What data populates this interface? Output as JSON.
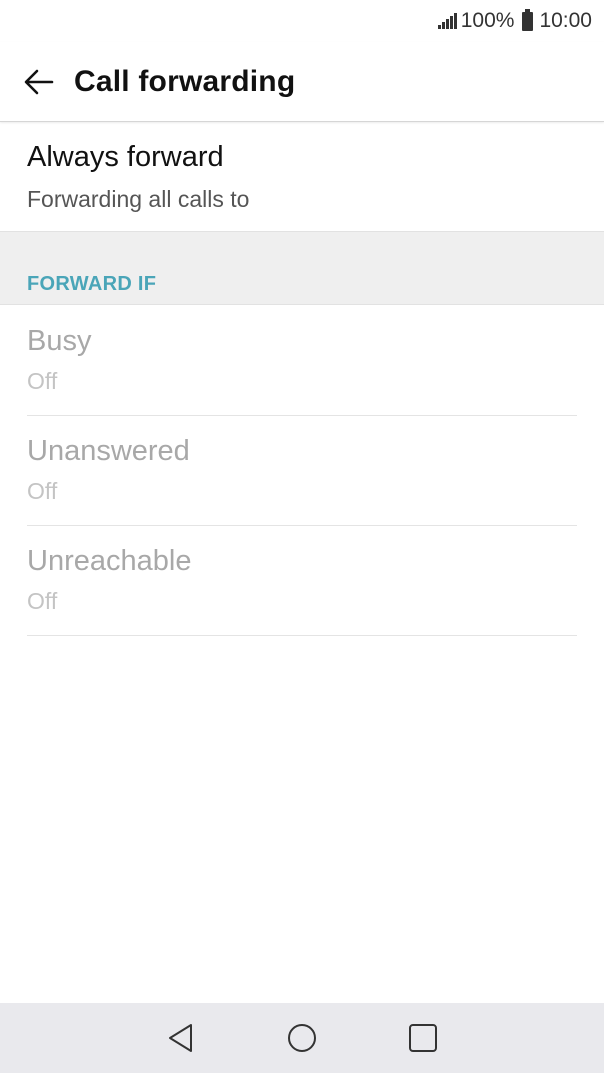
{
  "status_bar": {
    "battery": "100%",
    "time": "10:00",
    "icons": [
      "signal-icon",
      "battery-icon"
    ]
  },
  "app_bar": {
    "back_icon": "arrow-left-icon",
    "title": "Call forwarding"
  },
  "always_forward": {
    "title": "Always forward",
    "subtitle": "Forwarding all calls to"
  },
  "section": {
    "label": "FORWARD IF",
    "color": "#4aa5b8"
  },
  "conditions": [
    {
      "title": "Busy",
      "value": "Off"
    },
    {
      "title": "Unanswered",
      "value": "Off"
    },
    {
      "title": "Unreachable",
      "value": "Off"
    }
  ],
  "nav_bar": {
    "icons": [
      "back-triangle-icon",
      "home-circle-icon",
      "recents-square-icon"
    ]
  }
}
